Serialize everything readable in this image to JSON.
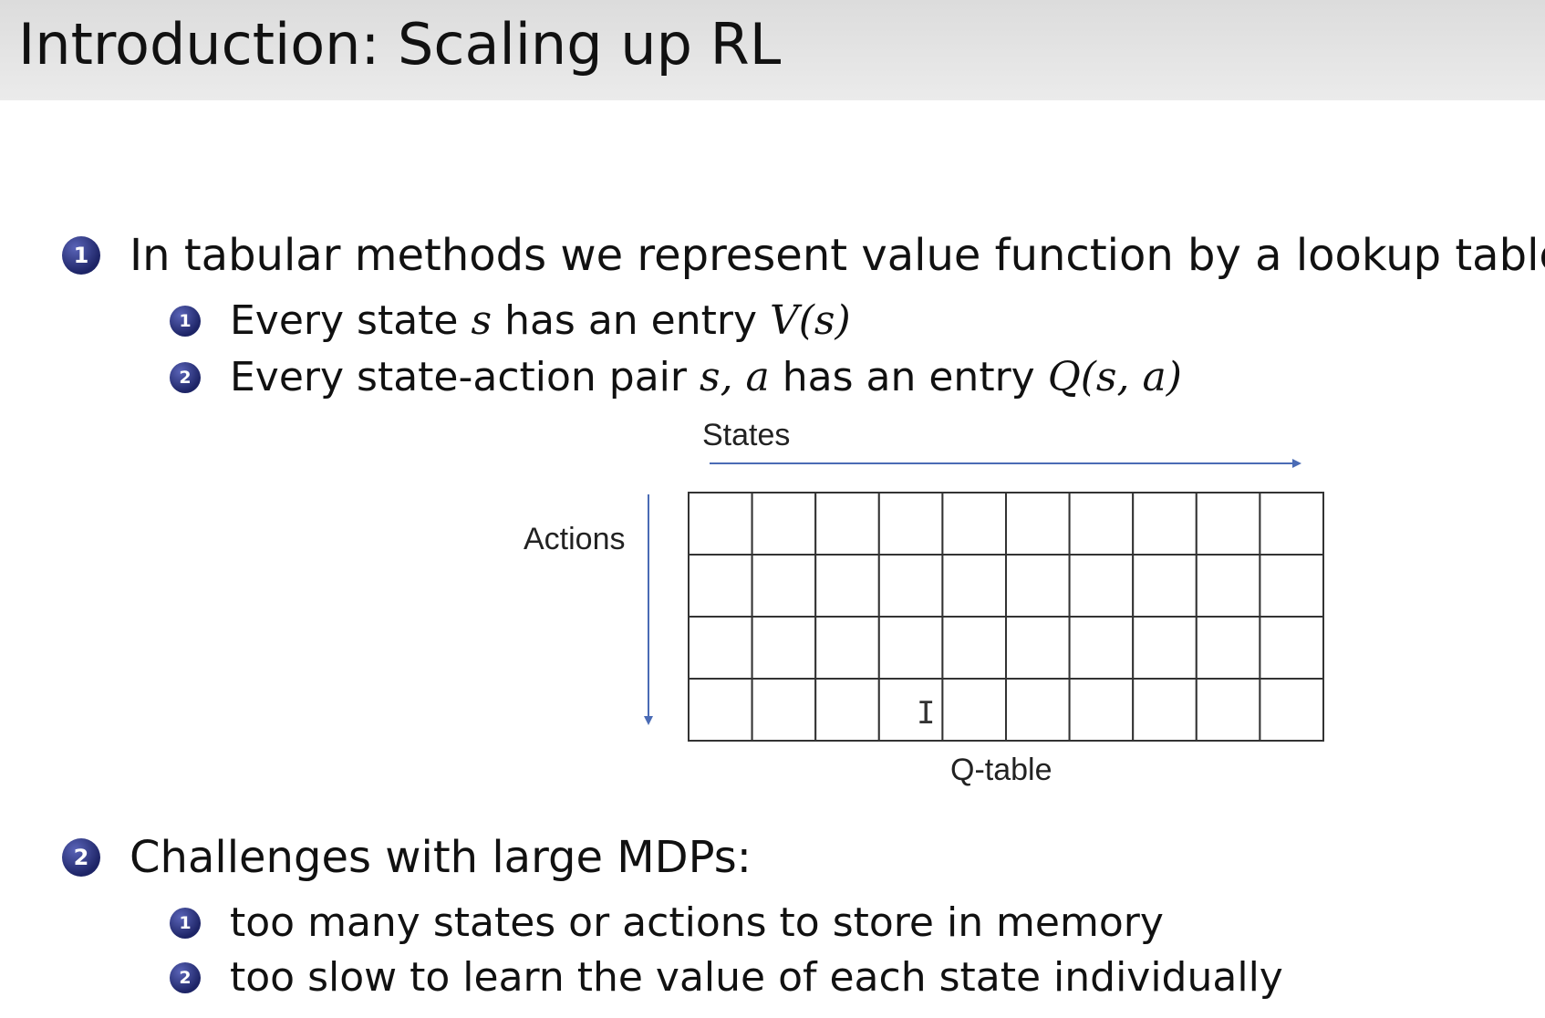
{
  "slide": {
    "title": "Introduction: Scaling up RL"
  },
  "bullets": [
    {
      "number": "1",
      "text": "In tabular methods we represent value function by a lookup table:",
      "subitems": [
        {
          "number": "1",
          "pre": "Every state ",
          "m1": "s",
          "mid": " has an entry ",
          "m2": "V(s)"
        },
        {
          "number": "2",
          "pre": "Every state-action pair ",
          "m1": "s, a",
          "mid": " has an entry ",
          "m2": "Q(s, a)"
        }
      ]
    },
    {
      "number": "2",
      "text": "Challenges with large MDPs:",
      "subitems": [
        {
          "number": "1",
          "text": "too many states or actions to store in memory"
        },
        {
          "number": "2",
          "text": "too slow to learn the value of each state individually"
        }
      ]
    }
  ],
  "diagram": {
    "states_label": "States",
    "actions_label": "Actions",
    "table_caption": "Q-table",
    "rows": 4,
    "columns": 10,
    "line_color": "#333333",
    "arrow_color": "#4a6bb5"
  }
}
